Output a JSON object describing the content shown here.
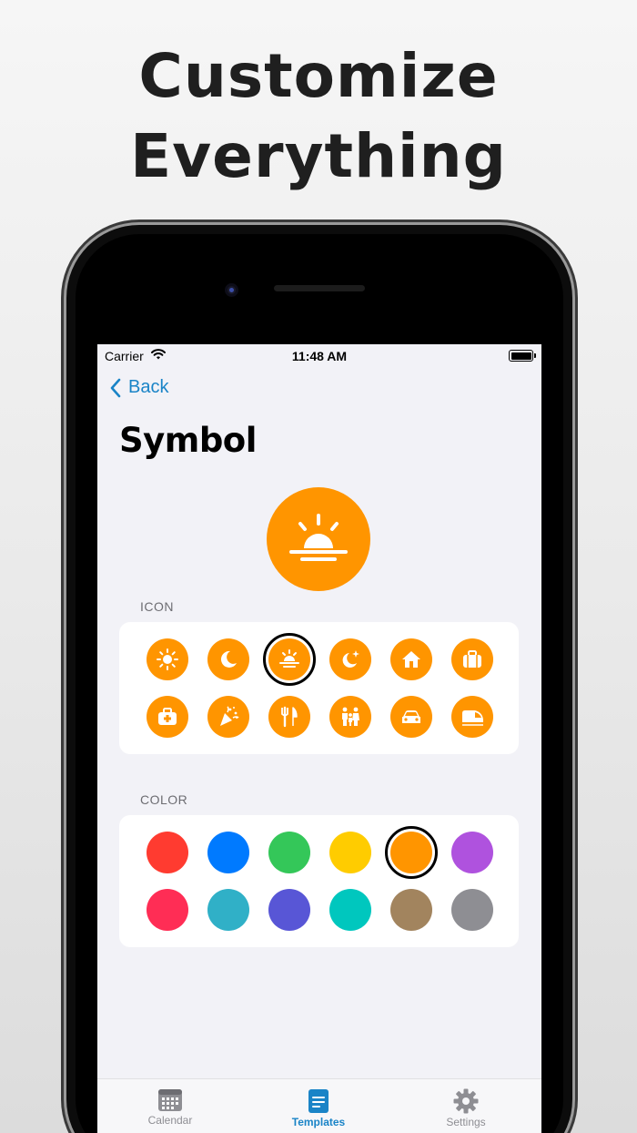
{
  "headline": {
    "line1": "Customize",
    "line2": "Everything"
  },
  "status_bar": {
    "carrier": "Carrier",
    "time": "11:48 AM"
  },
  "nav": {
    "back_label": "Back"
  },
  "page": {
    "title": "Symbol"
  },
  "preview": {
    "icon": "sunrise-icon",
    "color": "#FF9500"
  },
  "icon_section": {
    "label": "ICON",
    "selected_index": 2,
    "icons": [
      "sun-icon",
      "moon-icon",
      "sunrise-icon",
      "moon-stars-icon",
      "house-icon",
      "suitcase-icon",
      "first-aid-kit-icon",
      "party-popper-icon",
      "fork-knife-icon",
      "family-icon",
      "car-icon",
      "train-icon"
    ]
  },
  "color_section": {
    "label": "COLOR",
    "selected_index": 4,
    "colors": [
      "#FF3B30",
      "#007AFF",
      "#34C759",
      "#FFCC00",
      "#FF9500",
      "#AF52DE",
      "#FF2D55",
      "#30B0C7",
      "#5856D6",
      "#00C7BE",
      "#A2845E",
      "#8E8E93"
    ]
  },
  "tabbar": {
    "active": "templates",
    "tabs": [
      {
        "id": "calendar",
        "label": "Calendar",
        "icon": "calendar-icon"
      },
      {
        "id": "templates",
        "label": "Templates",
        "icon": "document-icon"
      },
      {
        "id": "settings",
        "label": "Settings",
        "icon": "gear-icon"
      }
    ]
  },
  "colors": {
    "accent": "#1A84C7",
    "icon_fill": "#FF9500",
    "screen_bg": "#F2F2F7"
  }
}
